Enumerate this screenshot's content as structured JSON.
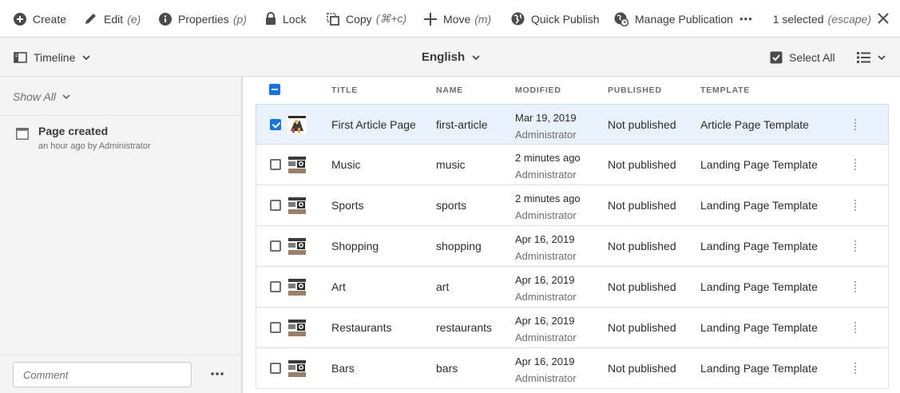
{
  "actionbar": {
    "create": "Create",
    "edit": "Edit",
    "edit_shortcut": "(e)",
    "properties": "Properties",
    "properties_shortcut": "(p)",
    "lock": "Lock",
    "copy": "Copy",
    "copy_shortcut": "(⌘+c)",
    "move": "Move",
    "move_shortcut": "(m)",
    "quick_publish": "Quick Publish",
    "manage_publication": "Manage Publication",
    "more": "•••",
    "selected_count": "1 selected",
    "selected_shortcut": "(escape)"
  },
  "toolbar": {
    "rail_label": "Timeline",
    "language": "English",
    "select_all": "Select All"
  },
  "rail": {
    "filter": "Show All",
    "entry_title": "Page created",
    "entry_meta": "an hour ago by Administrator",
    "comment_placeholder": "Comment",
    "more": "•••"
  },
  "table": {
    "headers": {
      "title": "TITLE",
      "name": "NAME",
      "modified": "MODIFIED",
      "published": "PUBLISHED",
      "template": "TEMPLATE"
    },
    "rows": [
      {
        "title": "First Article Page",
        "name": "first-article",
        "modified": "Mar 19, 2019",
        "modified_by": "Administrator",
        "published": "Not published",
        "template": "Article Page Template",
        "selected": true
      },
      {
        "title": "Music",
        "name": "music",
        "modified": "2 minutes ago",
        "modified_by": "Administrator",
        "published": "Not published",
        "template": "Landing Page Template",
        "selected": false
      },
      {
        "title": "Sports",
        "name": "sports",
        "modified": "2 minutes ago",
        "modified_by": "Administrator",
        "published": "Not published",
        "template": "Landing Page Template",
        "selected": false
      },
      {
        "title": "Shopping",
        "name": "shopping",
        "modified": "Apr 16, 2019",
        "modified_by": "Administrator",
        "published": "Not published",
        "template": "Landing Page Template",
        "selected": false
      },
      {
        "title": "Art",
        "name": "art",
        "modified": "Apr 16, 2019",
        "modified_by": "Administrator",
        "published": "Not published",
        "template": "Landing Page Template",
        "selected": false
      },
      {
        "title": "Restaurants",
        "name": "restaurants",
        "modified": "Apr 16, 2019",
        "modified_by": "Administrator",
        "published": "Not published",
        "template": "Landing Page Template",
        "selected": false
      },
      {
        "title": "Bars",
        "name": "bars",
        "modified": "Apr 16, 2019",
        "modified_by": "Administrator",
        "published": "Not published",
        "template": "Landing Page Template",
        "selected": false
      }
    ]
  },
  "colors": {
    "accent": "#1473e6",
    "selected_row": "#e9f1fb",
    "rail_bg": "#f4f4f4"
  }
}
